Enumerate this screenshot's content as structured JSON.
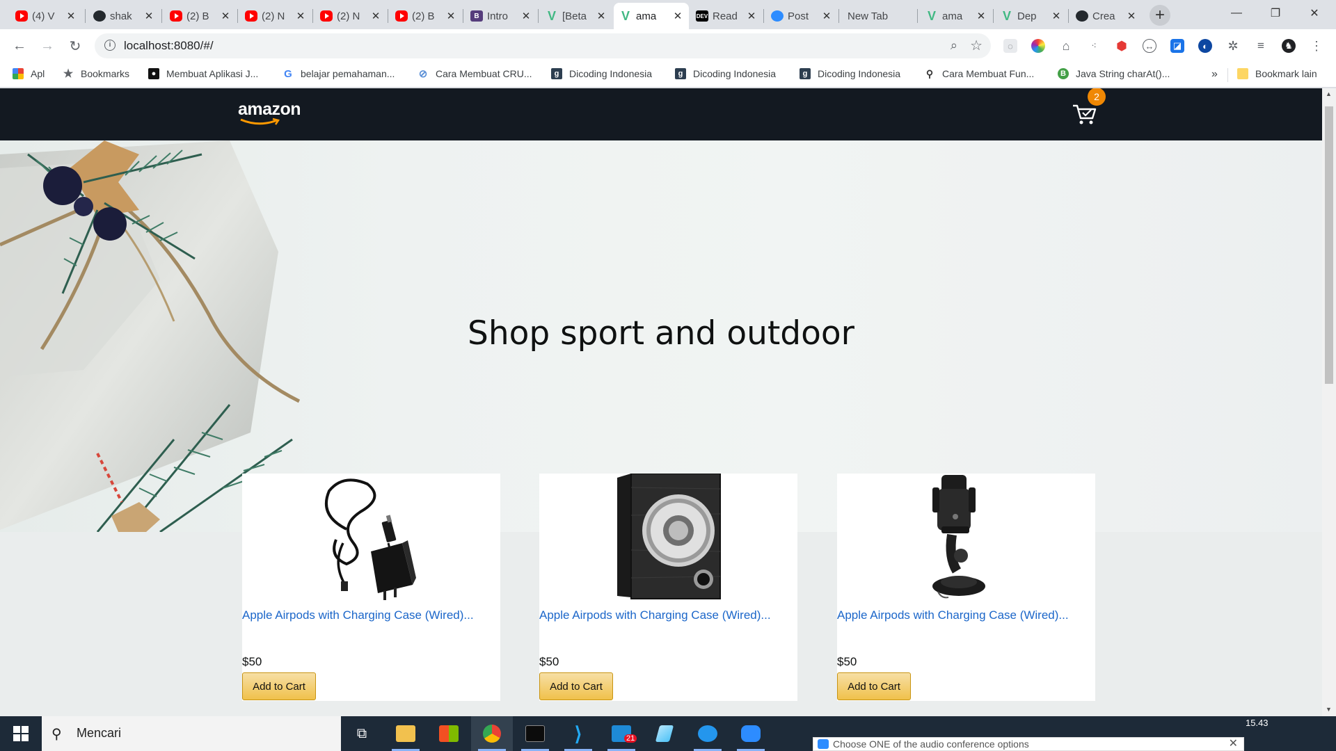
{
  "browser": {
    "tabs": [
      {
        "icon": "youtube-icon",
        "title": "(4) V"
      },
      {
        "icon": "github-icon",
        "title": "shak"
      },
      {
        "icon": "youtube-icon",
        "title": "(2) B"
      },
      {
        "icon": "youtube-icon",
        "title": "(2) N"
      },
      {
        "icon": "youtube-icon",
        "title": "(2) N"
      },
      {
        "icon": "youtube-icon",
        "title": "(2) B"
      },
      {
        "icon": "bootstrap-icon",
        "title": "Intro"
      },
      {
        "icon": "vue-icon",
        "title": "[Beta"
      },
      {
        "icon": "vue-icon",
        "title": "ama",
        "active": true
      },
      {
        "icon": "dev-icon",
        "title": "Read"
      },
      {
        "icon": "zoom-icon",
        "title": "Post"
      },
      {
        "icon": "none",
        "title": "New Tab"
      },
      {
        "icon": "vue-icon",
        "title": "ama"
      },
      {
        "icon": "vue-icon",
        "title": "Dep"
      },
      {
        "icon": "github-icon",
        "title": "Crea"
      }
    ],
    "url": "localhost:8080/#/",
    "bookmarks": [
      {
        "icon": "apps-icon",
        "label": "Apl"
      },
      {
        "icon": "star-icon",
        "label": "Bookmarks"
      },
      {
        "icon": "site-icon",
        "label": "Membuat Aplikasi J..."
      },
      {
        "icon": "google-icon",
        "label": "belajar pemahaman..."
      },
      {
        "icon": "site-icon",
        "label": "Cara Membuat CRU..."
      },
      {
        "icon": "dicoding-icon",
        "label": "Dicoding Indonesia"
      },
      {
        "icon": "dicoding-icon",
        "label": "Dicoding Indonesia"
      },
      {
        "icon": "dicoding-icon",
        "label": "Dicoding Indonesia"
      },
      {
        "icon": "site-icon",
        "label": "Cara Membuat Fun..."
      },
      {
        "icon": "site-icon",
        "label": "Java String charAt()..."
      }
    ],
    "bookmarks_more": "»",
    "other_bookmarks": "Bookmark lain"
  },
  "site": {
    "logo": "amazon",
    "cart_count": "2",
    "hero_title": "Shop sport and outdoor",
    "products": [
      {
        "title": "Apple Airpods with Charging Case (Wired)...",
        "price": "$50",
        "button": "Add to Cart",
        "image": "charger-cable-image"
      },
      {
        "title": "Apple Airpods with Charging Case (Wired)...",
        "price": "$50",
        "button": "Add to Cart",
        "image": "subwoofer-speaker-image"
      },
      {
        "title": "Apple Airpods with Charging Case (Wired)...",
        "price": "$50",
        "button": "Add to Cart",
        "image": "phone-car-mount-image"
      }
    ]
  },
  "taskbar": {
    "search_placeholder": "Mencari",
    "mail_badge": "21",
    "notification": "Choose ONE of the audio conference options",
    "time": "15.43"
  },
  "colors": {
    "header_bg": "#131921",
    "link": "#1b66c9",
    "button": "#f0c14b",
    "badge": "#f08804"
  }
}
